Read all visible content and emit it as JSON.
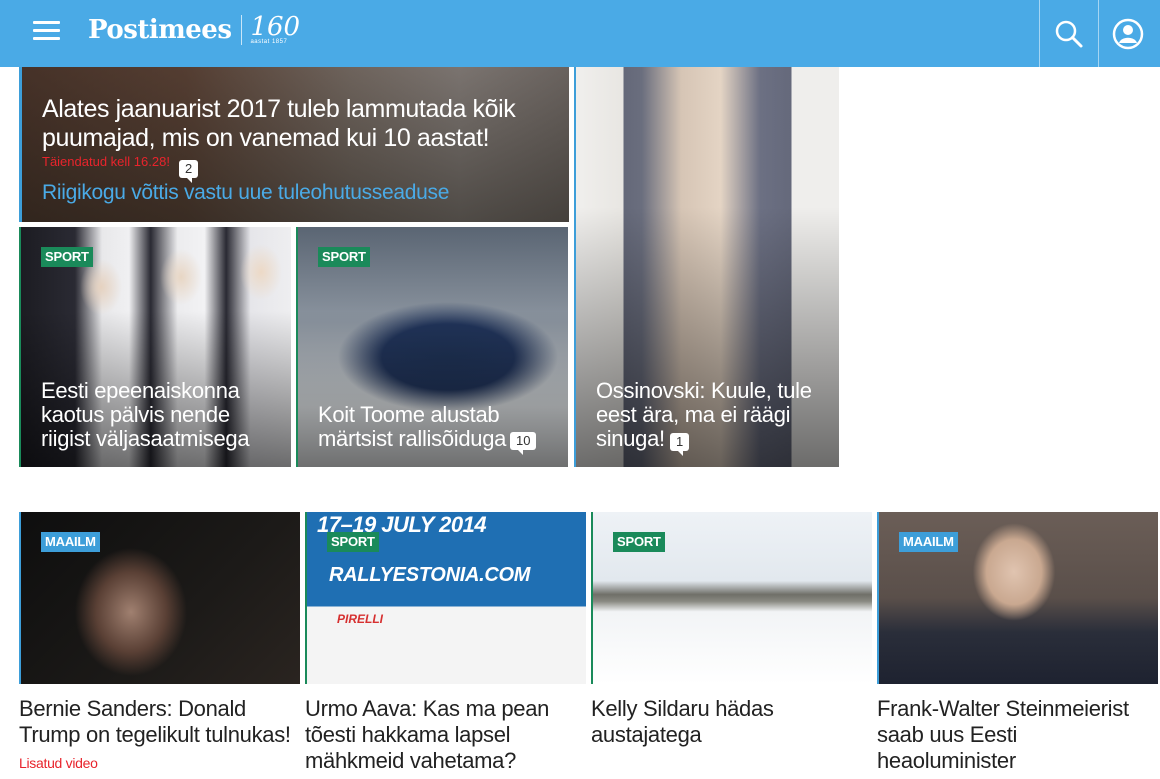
{
  "header": {
    "logo_text": "Postimees",
    "anniversary_number": "160",
    "anniversary_sub": "aastat 1857",
    "brand_color": "#4aaae6",
    "icons": {
      "menu": "hamburger-menu-icon",
      "search": "search-icon",
      "user": "user-icon"
    }
  },
  "lead": {
    "title": "Alates jaanuarist 2017 tuleb lammutada kõik puumajad, mis on vanemad kui 10 aastat!",
    "updated": "Täiendatud kell 16.28!",
    "comments": "2",
    "related_link": "Riigikogu võttis vastu uue tuleohutusseaduse"
  },
  "tiles": [
    {
      "tag": "SPORT",
      "title": "Eesti epeenaiskonna kaotus pälvis nende riigist väljasaatmisega",
      "comments": ""
    },
    {
      "tag": "SPORT",
      "title": "Koit Toome alustab märtsist rallisõiduga",
      "comments": "10"
    },
    {
      "tag": "",
      "title": "Ossinovski: Kuule, tule eest ära, ma ei räägi sinuga!",
      "comments": "1"
    }
  ],
  "cards": [
    {
      "tag": "MAAILM",
      "headline": "Bernie Sanders: Donald Trump on tegelikult tulnukas!",
      "note": "Lisatud video"
    },
    {
      "tag": "SPORT",
      "headline": "Urmo Aava: Kas ma pean tõesti hakkama lapsel mähkmeid vahetama?",
      "note": ""
    },
    {
      "tag": "SPORT",
      "headline": "Kelly Sildaru hädas austajatega",
      "note": ""
    },
    {
      "tag": "MAAILM",
      "headline": "Frank-Walter Steinmeierist saab uus Eesti heaoluminister",
      "note": ""
    }
  ],
  "image_text": {
    "rally_dates": "17–19 JULY 2014",
    "rally_site": "RALLYESTONIA.COM",
    "sponsor": "PIRELLI"
  },
  "colors": {
    "sport_tag": "#1a8a5a",
    "world_tag": "#3d9ed9",
    "updated_text": "#e8242c",
    "link": "#4aaae6"
  }
}
